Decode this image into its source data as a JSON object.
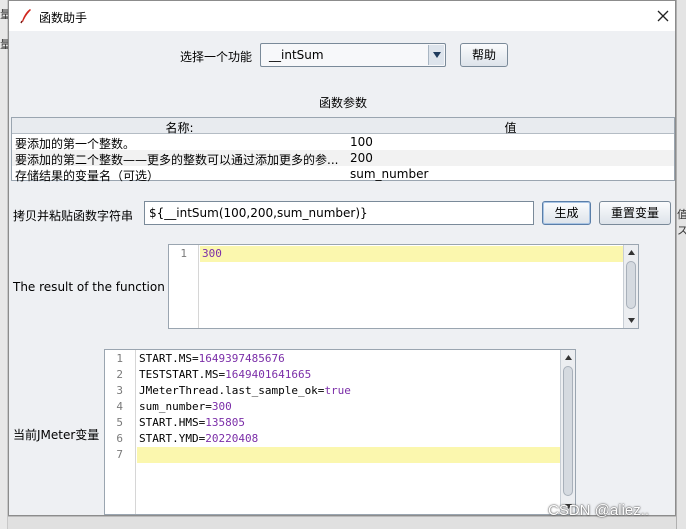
{
  "window": {
    "title": "函数助手"
  },
  "function_select": {
    "label": "选择一个功能",
    "selected": "__intSum",
    "help_button": "帮助"
  },
  "params": {
    "section_title": "函数参数",
    "columns": [
      "名称:",
      "值"
    ],
    "rows": [
      {
        "name": "要添加的第一个整数。",
        "value": "100"
      },
      {
        "name": "要添加的第二个整数——更多的整数可以通过添加更多的参...",
        "value": "200"
      },
      {
        "name": "存储结果的变量名（可选）",
        "value": "sum_number"
      }
    ]
  },
  "function_string": {
    "label": "拷贝并粘贴函数字符串",
    "value": "${__intSum(100,200,sum_number)}",
    "generate_button": "生成",
    "reset_button": "重置变量"
  },
  "result": {
    "label": "The result of the function is",
    "lines": [
      {
        "num": "1",
        "text": "300"
      }
    ]
  },
  "jmeter_vars": {
    "label": "当前JMeter变量",
    "lines": [
      {
        "num": "1",
        "key": "START.MS=",
        "value": "1649397485676"
      },
      {
        "num": "2",
        "key": "TESTSTART.MS=",
        "value": "1649401641665"
      },
      {
        "num": "3",
        "key": "JMeterThread.last_sample_ok=",
        "value": "true"
      },
      {
        "num": "4",
        "key": "sum_number=",
        "value": "300"
      },
      {
        "num": "5",
        "key": "START.HMS=",
        "value": "135805"
      },
      {
        "num": "6",
        "key": "START.YMD=",
        "value": "20220408"
      },
      {
        "num": "7",
        "key": "",
        "value": ""
      }
    ]
  },
  "background": {
    "left_fragments": [
      "量",
      "量"
    ],
    "right_fragments": [
      "值",
      "ス"
    ]
  },
  "watermark": "CSDN @aliez..",
  "colors": {
    "highlight": "#fbf7ae",
    "value_text": "#7b2ea8",
    "dialog_bg": "#eef0f3"
  }
}
